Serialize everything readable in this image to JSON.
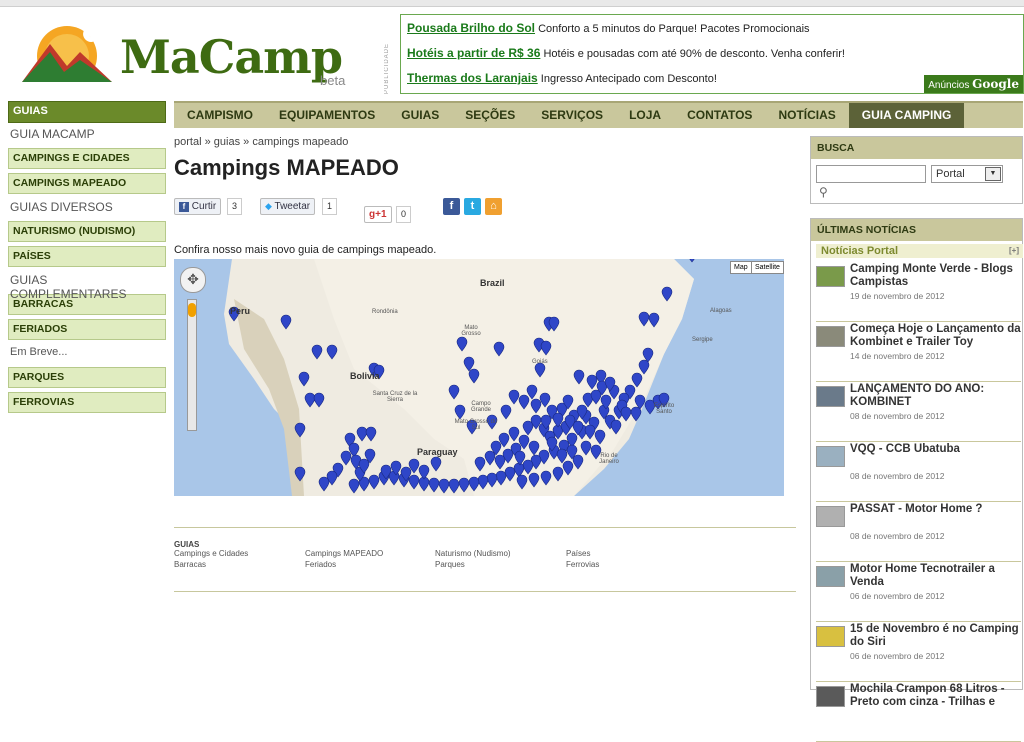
{
  "logo": {
    "name": "MaCamp",
    "tag": "beta"
  },
  "ads": {
    "label": "PUBLICIDADE",
    "items": [
      {
        "title": "Pousada Brilho do Sol",
        "text": "Conforto a 5 minutos do Parque! Pacotes Promocionais"
      },
      {
        "title": "Hotéis a partir de R$ 36",
        "text": "Hotéis e pousadas com até 90% de desconto. Venha conferir!"
      },
      {
        "title": "Thermas dos Laranjais",
        "text": "Ingresso Antecipado com Desconto!"
      }
    ],
    "google_prefix": "Anúncios",
    "google_brand": "Google"
  },
  "sidebar": {
    "header": "GUIAS",
    "items": [
      {
        "label": "GUIA MACAMP",
        "kind": "text"
      },
      {
        "label": "CAMPINGS E CIDADES",
        "kind": "button"
      },
      {
        "label": "CAMPINGS MAPEADO",
        "kind": "button"
      },
      {
        "label": "GUIAS DIVERSOS",
        "kind": "text"
      },
      {
        "label": "NATURISMO (NUDISMO)",
        "kind": "button"
      },
      {
        "label": "PAÍSES",
        "kind": "button"
      },
      {
        "label": "GUIAS COMPLEMENTARES",
        "kind": "text"
      },
      {
        "label": "BARRACAS",
        "kind": "button"
      },
      {
        "label": "FERIADOS",
        "kind": "button"
      },
      {
        "label": "Em Breve...",
        "kind": "small"
      },
      {
        "label": "PARQUES",
        "kind": "button"
      },
      {
        "label": "FERROVIAS",
        "kind": "button"
      }
    ]
  },
  "nav": {
    "items": [
      "CAMPISMO",
      "EQUIPAMENTOS",
      "GUIAS",
      "SEÇÕES",
      "SERVIÇOS",
      "LOJA",
      "CONTATOS",
      "NOTÍCIAS",
      "GUIA CAMPING"
    ],
    "active": "GUIA CAMPING"
  },
  "breadcrumb": {
    "portal": "portal",
    "sep1": "»",
    "guias": "guias",
    "sep2": "»",
    "current": "campings mapeado"
  },
  "page": {
    "title": "Campings MAPEADO",
    "intro": "Confira nosso mais novo guia de campings mapeado."
  },
  "social": {
    "like_label": "Curtir",
    "like_count": "3",
    "tweet_label": "Tweetar",
    "tweet_count": "1",
    "plus_label": "+1",
    "plus_count": "0",
    "fb_glyph": "f",
    "tw_glyph": "t",
    "rss_glyph": "⌂"
  },
  "map": {
    "type_buttons": [
      "Map",
      "Satellite"
    ],
    "countries": [
      "Brazil",
      "Peru",
      "Bolivia",
      "Paraguay"
    ],
    "places": [
      "Rondônia",
      "Mato Grosso",
      "Goiás",
      "Alagoas",
      "Sergipe",
      "Santa Cruz de la Sierra",
      "Campo Grande",
      "Mato Grosso do Sul",
      "Espírito Santo",
      "Rio de Janeiro"
    ],
    "marker_color": "#2f46c8",
    "ocean_color": "#a9c6e8",
    "land_color": "#efebe1"
  },
  "footer": {
    "header": "GUIAS",
    "links": [
      "Campings e Cidades",
      "Campings MAPEADO",
      "Naturismo (Nudismo)",
      "Países",
      "Barracas",
      "Feriados",
      "Parques",
      "Ferrovias"
    ]
  },
  "search": {
    "header": "BUSCA",
    "input_value": "",
    "select_value": "Portal",
    "arrow": "▼",
    "icon": "⚲"
  },
  "news": {
    "header": "ÚLTIMAS NOTÍCIAS",
    "sub": "Notícias Portal",
    "plus": "[+]",
    "items": [
      {
        "title": "Camping Monte Verde - Blogs Campistas",
        "date": "19 de novembro de 2012"
      },
      {
        "title": "Começa Hoje o Lançamento da Kombinet e Trailer Toy",
        "date": "14 de novembro de 2012"
      },
      {
        "title": "LANÇAMENTO DO ANO: KOMBINET",
        "date": "08 de novembro de 2012"
      },
      {
        "title": "VQQ - CCB Ubatuba",
        "date": "08 de novembro de 2012"
      },
      {
        "title": "PASSAT - Motor Home ?",
        "date": "08 de novembro de 2012"
      },
      {
        "title": "Motor Home Tecnotrailer a Venda",
        "date": "06 de novembro de 2012"
      },
      {
        "title": "15 de Novembro é no Camping do Siri",
        "date": "06 de novembro de 2012"
      },
      {
        "title": "Mochila Crampon 68 Litros - Preto com cinza - Trilhas e",
        "date": ""
      }
    ]
  }
}
